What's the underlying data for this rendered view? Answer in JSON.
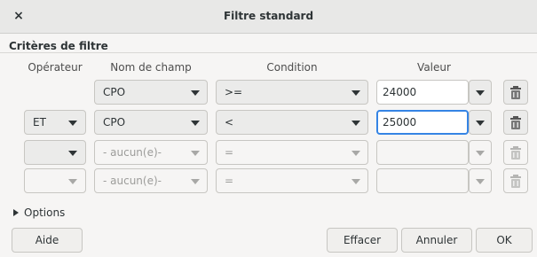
{
  "window": {
    "title": "Filtre standard",
    "close_glyph": "×"
  },
  "section": {
    "title": "Critères de filtre"
  },
  "headers": {
    "operator": "Opérateur",
    "field": "Nom de champ",
    "condition": "Condition",
    "value": "Valeur"
  },
  "rows": [
    {
      "operator": "",
      "field": "CPO",
      "condition": ">=",
      "value": "24000"
    },
    {
      "operator": "ET",
      "field": "CPO",
      "condition": "<",
      "value": "25000"
    },
    {
      "operator": "",
      "field": "- aucun(e)-",
      "condition": "=",
      "value": ""
    },
    {
      "operator": "",
      "field": "- aucun(e)-",
      "condition": "=",
      "value": ""
    }
  ],
  "options": {
    "label": "Options"
  },
  "buttons": {
    "help": "Aide",
    "clear": "Effacer",
    "cancel": "Annuler",
    "ok": "OK"
  },
  "icons": {
    "close": "close-icon",
    "dropdown": "chevron-down-icon",
    "delete": "trash-icon",
    "expander": "expander-triangle-icon"
  },
  "colors": {
    "focus_border": "#3584e4",
    "titlebar_bg": "#e8e8e7",
    "window_bg": "#f6f5f4"
  }
}
